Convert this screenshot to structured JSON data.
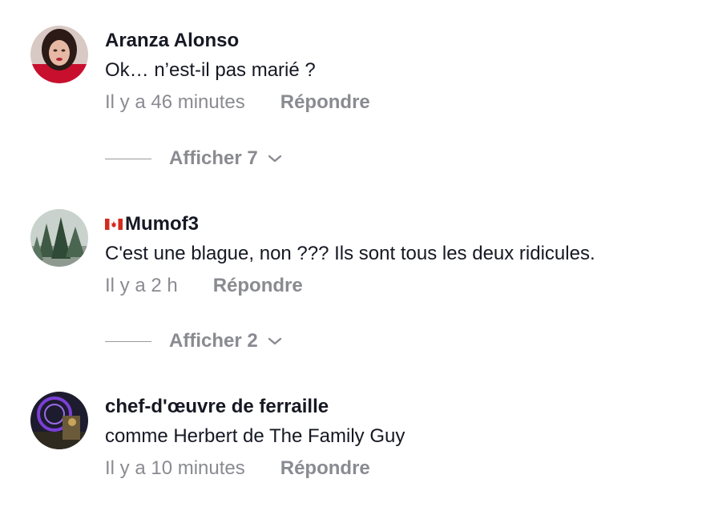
{
  "comments": [
    {
      "username": "Aranza Alonso",
      "text": "Ok… n’est-il pas marié ?",
      "time": "Il y a 46 minutes",
      "reply_label": "Répondre",
      "show_replies": "Afficher 7"
    },
    {
      "username": "Mumof3",
      "flag": "canada-flag-icon",
      "text": "C'est une blague, non ??? Ils sont tous les deux ridicules.",
      "time": "Il y a 2 h",
      "reply_label": "Répondre",
      "show_replies": "Afficher 2"
    },
    {
      "username": "chef-d'œuvre de ferraille",
      "text": "comme Herbert de The Family Guy",
      "time": "Il y a 10 minutes",
      "reply_label": "Répondre"
    }
  ],
  "colors": {
    "text": "#161823",
    "muted": "#8a8b91",
    "background": "#ffffff"
  }
}
